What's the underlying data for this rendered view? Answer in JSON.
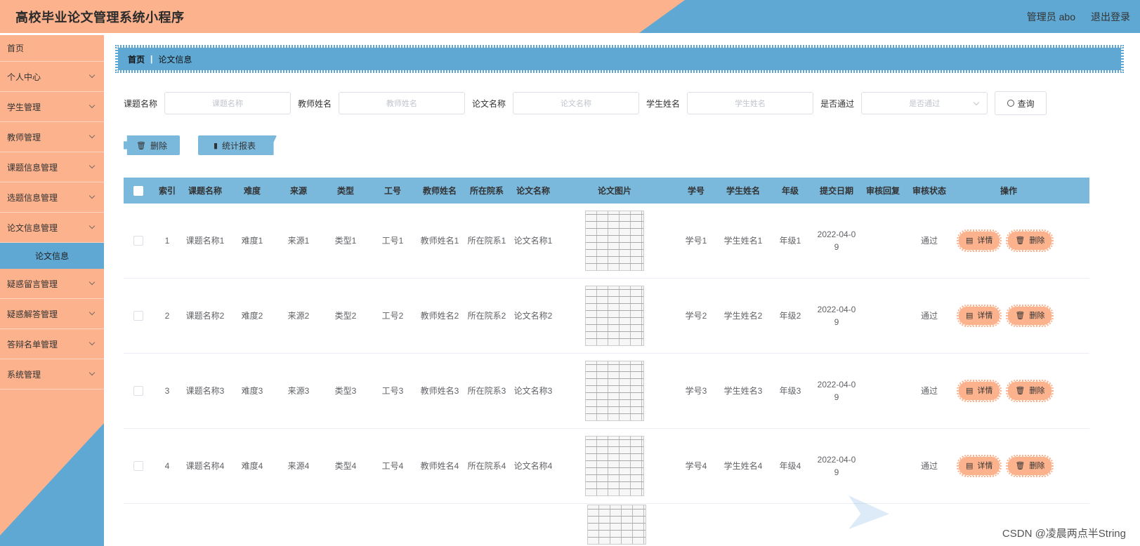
{
  "header": {
    "title": "高校毕业论文管理系统小程序",
    "user": "管理员 abo",
    "logout": "退出登录"
  },
  "sidebar": {
    "items": [
      {
        "label": "首页",
        "has_children": false
      },
      {
        "label": "个人中心",
        "has_children": true
      },
      {
        "label": "学生管理",
        "has_children": true
      },
      {
        "label": "教师管理",
        "has_children": true
      },
      {
        "label": "课题信息管理",
        "has_children": true
      },
      {
        "label": "选题信息管理",
        "has_children": true
      },
      {
        "label": "论文信息管理",
        "has_children": true
      },
      {
        "label": "疑惑留言管理",
        "has_children": true
      },
      {
        "label": "疑惑解答管理",
        "has_children": true
      },
      {
        "label": "答辩名单管理",
        "has_children": true
      },
      {
        "label": "系统管理",
        "has_children": true
      }
    ],
    "subitem": "论文信息"
  },
  "breadcrumb": {
    "home": "首页",
    "current": "论文信息"
  },
  "search": {
    "topic_label": "课题名称",
    "topic_placeholder": "课题名称",
    "teacher_label": "教师姓名",
    "teacher_placeholder": "教师姓名",
    "paper_label": "论文名称",
    "paper_placeholder": "论文名称",
    "student_label": "学生姓名",
    "student_placeholder": "学生姓名",
    "pass_label": "是否通过",
    "pass_placeholder": "是否通过",
    "query": "查询"
  },
  "actions": {
    "delete": "删除",
    "report": "统计报表"
  },
  "table": {
    "headers": [
      "索引",
      "课题名称",
      "难度",
      "来源",
      "类型",
      "工号",
      "教师姓名",
      "所在院系",
      "论文名称",
      "论文图片",
      "学号",
      "学生姓名",
      "年级",
      "提交日期",
      "审核回复",
      "审核状态",
      "操作"
    ],
    "rows": [
      {
        "index": "1",
        "topic": "课题名称1",
        "difficulty": "难度1",
        "source": "来源1",
        "type": "类型1",
        "work_id": "工号1",
        "teacher": "教师姓名1",
        "dept": "所在院系1",
        "paper": "论文名称1",
        "student_id": "学号1",
        "student": "学生姓名1",
        "grade": "年级1",
        "date": "2022-04-09",
        "reply": "",
        "status": "通过"
      },
      {
        "index": "2",
        "topic": "课题名称2",
        "difficulty": "难度2",
        "source": "来源2",
        "type": "类型2",
        "work_id": "工号2",
        "teacher": "教师姓名2",
        "dept": "所在院系2",
        "paper": "论文名称2",
        "student_id": "学号2",
        "student": "学生姓名2",
        "grade": "年级2",
        "date": "2022-04-09",
        "reply": "",
        "status": "通过"
      },
      {
        "index": "3",
        "topic": "课题名称3",
        "difficulty": "难度3",
        "source": "来源3",
        "type": "类型3",
        "work_id": "工号3",
        "teacher": "教师姓名3",
        "dept": "所在院系3",
        "paper": "论文名称3",
        "student_id": "学号3",
        "student": "学生姓名3",
        "grade": "年级3",
        "date": "2022-04-09",
        "reply": "",
        "status": "通过"
      },
      {
        "index": "4",
        "topic": "课题名称4",
        "difficulty": "难度4",
        "source": "来源4",
        "type": "类型4",
        "work_id": "工号4",
        "teacher": "教师姓名4",
        "dept": "所在院系4",
        "paper": "论文名称4",
        "student_id": "学号4",
        "student": "学生姓名4",
        "grade": "年级4",
        "date": "2022-04-09",
        "reply": "",
        "status": "通过"
      }
    ],
    "detail": "详情",
    "delete": "删除"
  },
  "watermark": "CSDN @凌晨两点半String",
  "colors": {
    "accent_orange": "#fbb28d",
    "accent_blue": "#5fa8d3"
  }
}
